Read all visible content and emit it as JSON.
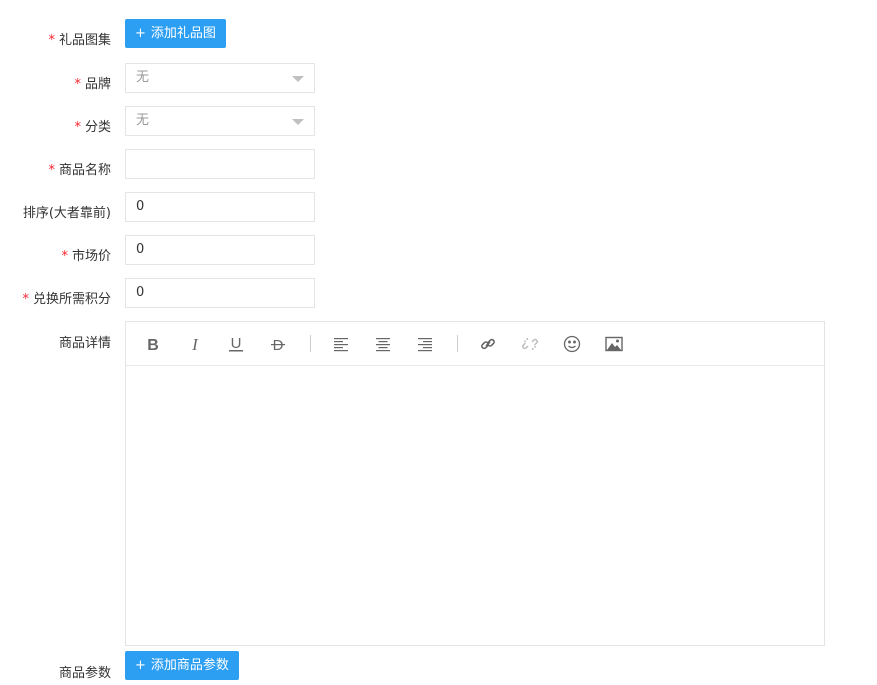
{
  "form": {
    "gift_images": {
      "label": "礼品图集",
      "required": true,
      "button": "添加礼品图"
    },
    "brand": {
      "label": "品牌",
      "required": true,
      "value": "无"
    },
    "category": {
      "label": "分类",
      "required": true,
      "value": "无"
    },
    "product_name": {
      "label": "商品名称",
      "required": true,
      "value": ""
    },
    "sort": {
      "label": "排序(大者靠前)",
      "required": false,
      "value": "0"
    },
    "market_price": {
      "label": "市场价",
      "required": true,
      "value": "0"
    },
    "points": {
      "label": "兑换所需积分",
      "required": true,
      "value": "0"
    },
    "details": {
      "label": "商品详情"
    },
    "params": {
      "label": "商品参数",
      "button": "添加商品参数"
    }
  },
  "editor_toolbar": {
    "icons": [
      "bold-icon",
      "italic-icon",
      "underline-icon",
      "strikethrough-icon",
      "align-left-icon",
      "align-center-icon",
      "align-right-icon",
      "link-icon",
      "unlink-icon",
      "emoji-icon",
      "image-icon"
    ]
  },
  "theme": {
    "primary": "#2d9ff3",
    "required": "#f5222d",
    "border": "#e4e4e4"
  }
}
